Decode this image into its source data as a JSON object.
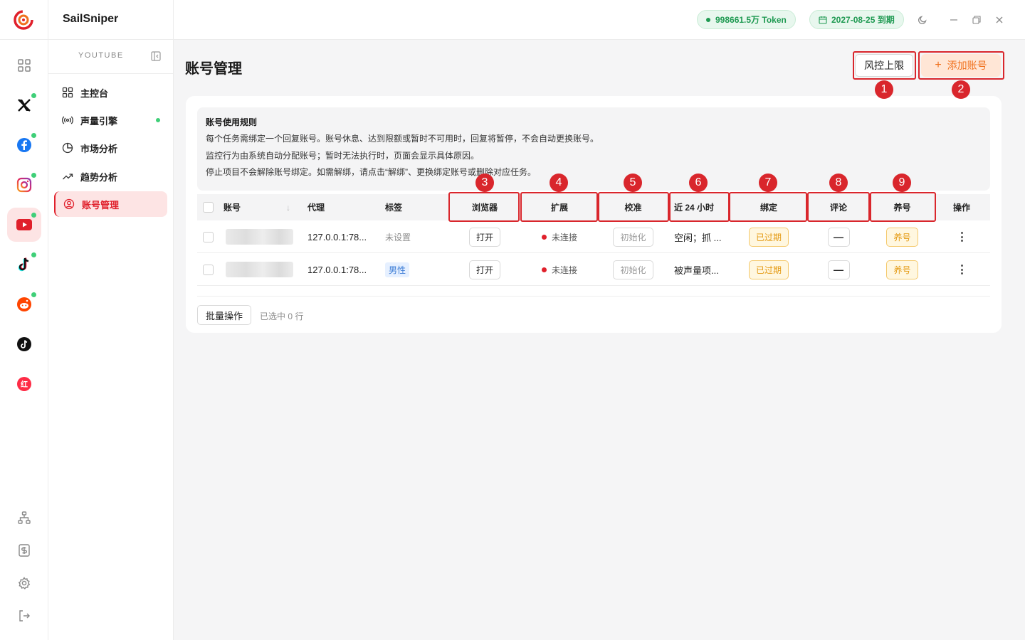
{
  "app": {
    "name": "SailSniper"
  },
  "topbar": {
    "token_pill": "998661.5万 Token",
    "expiry_pill": "2027-08-25 到期"
  },
  "sidebar": {
    "section": "YOUTUBE",
    "items": [
      {
        "label": "主控台",
        "icon": "dashboard-icon"
      },
      {
        "label": "声量引擎",
        "icon": "radio-icon",
        "dot": true
      },
      {
        "label": "市场分析",
        "icon": "pie-icon"
      },
      {
        "label": "趋势分析",
        "icon": "trend-icon"
      },
      {
        "label": "账号管理",
        "icon": "user-circle-icon",
        "active": true
      }
    ]
  },
  "rail": {
    "platforms": [
      "grid-icon",
      "x-icon",
      "facebook-icon",
      "instagram-icon",
      "youtube-icon",
      "tiktok-icon",
      "reddit-icon",
      "tiktok-alt-icon",
      "xiaohongshu-icon"
    ],
    "xiaohongshu_text": "红",
    "bottom": [
      "org-icon",
      "billing-icon",
      "settings-icon",
      "logout-icon"
    ]
  },
  "page": {
    "title": "账号管理",
    "risk_button": "风控上限",
    "add_button": "添加账号",
    "add_plus": "+"
  },
  "rules": {
    "title": "账号使用规则",
    "lines": [
      "每个任务需绑定一个回复账号。账号休息、达到限额或暂时不可用时，回复将暂停，不会自动更换账号。",
      "监控行为由系统自动分配账号；暂时无法执行时，页面会显示具体原因。",
      "停止项目不会解除账号绑定。如需解绑，请点击“解绑”、更换绑定账号或删除对应任务。"
    ]
  },
  "table": {
    "columns": [
      "账号",
      "代理",
      "标签",
      "浏览器",
      "扩展",
      "校准",
      "近 24 小时",
      "绑定",
      "评论",
      "养号",
      "操作"
    ],
    "sort_glyph": "↓",
    "rows": [
      {
        "proxy": "127.0.0.1:78...",
        "tag": "未设置",
        "tag_style": "muted",
        "browser": "打开",
        "ext": "未连接",
        "calib": "初始化",
        "last24": "空闲；抓 ...",
        "bind": "已过期",
        "comment": "—",
        "nurture": "养号"
      },
      {
        "proxy": "127.0.0.1:78...",
        "tag": "男性",
        "tag_style": "blue",
        "browser": "打开",
        "ext": "未连接",
        "calib": "初始化",
        "last24": "被声量项...",
        "bind": "已过期",
        "comment": "—",
        "nurture": "养号"
      }
    ]
  },
  "footer": {
    "batch": "批量操作",
    "selected": "已选中 0 行"
  },
  "annotations": [
    "1",
    "2",
    "3",
    "4",
    "5",
    "6",
    "7",
    "8",
    "9"
  ],
  "colors": {
    "accent": "#e0202b",
    "annotation": "#d9262c",
    "success": "#1f9a52",
    "warning": "#e49a12",
    "orange": "#f0711e"
  }
}
